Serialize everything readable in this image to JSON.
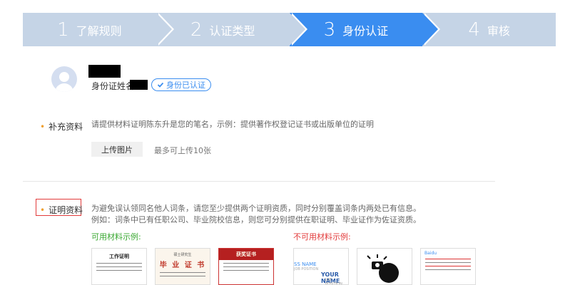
{
  "steps": [
    {
      "num": "1",
      "label": "了解规则",
      "active": false
    },
    {
      "num": "2",
      "label": "认证类型",
      "active": false
    },
    {
      "num": "3",
      "label": "身份认证",
      "active": true
    },
    {
      "num": "4",
      "label": "审核",
      "active": false
    }
  ],
  "profile": {
    "name_label": "身份证姓名",
    "verified_badge": "身份已认证"
  },
  "supplement": {
    "label": "补充资料",
    "hint": "请提供材料证明陈东升是您的笔名，示例：提供著作权登记证书或出版单位的证明",
    "upload_button": "上传图片",
    "upload_note": "最多可上传10张"
  },
  "proof": {
    "label": "证明资料",
    "hint_line1": "为避免误认领同名他人词条，请您至少提供两个证明资质，同时分别覆盖词条内两处已有信息。",
    "hint_line2": "例如：词条中已有任职公司、毕业院校信息，则您可分别提供在职证明、毕业证作为佐证资质。",
    "usable_title": "可用材料示例:",
    "unusable_title": "不可用材料示例:",
    "thumbs": {
      "work_cert": "工作证明",
      "grad_school": "硕士研究生",
      "grad_cert": "毕 业 证 书",
      "award_cert": "获奖证书",
      "biz_name_a": "SS NAME",
      "biz_pos_a": "JOB POSITION",
      "biz_name_b": "YOUR NAME",
      "biz_pos_b": "JOB POSITION",
      "baidu_logo": "Baidu"
    }
  },
  "colors": {
    "step_inactive": "#c5d4e6",
    "step_active": "#3a8df0",
    "usable_green": "#3aa832",
    "unusable_red": "#e23b3b",
    "bullet_orange": "#f0a030"
  }
}
